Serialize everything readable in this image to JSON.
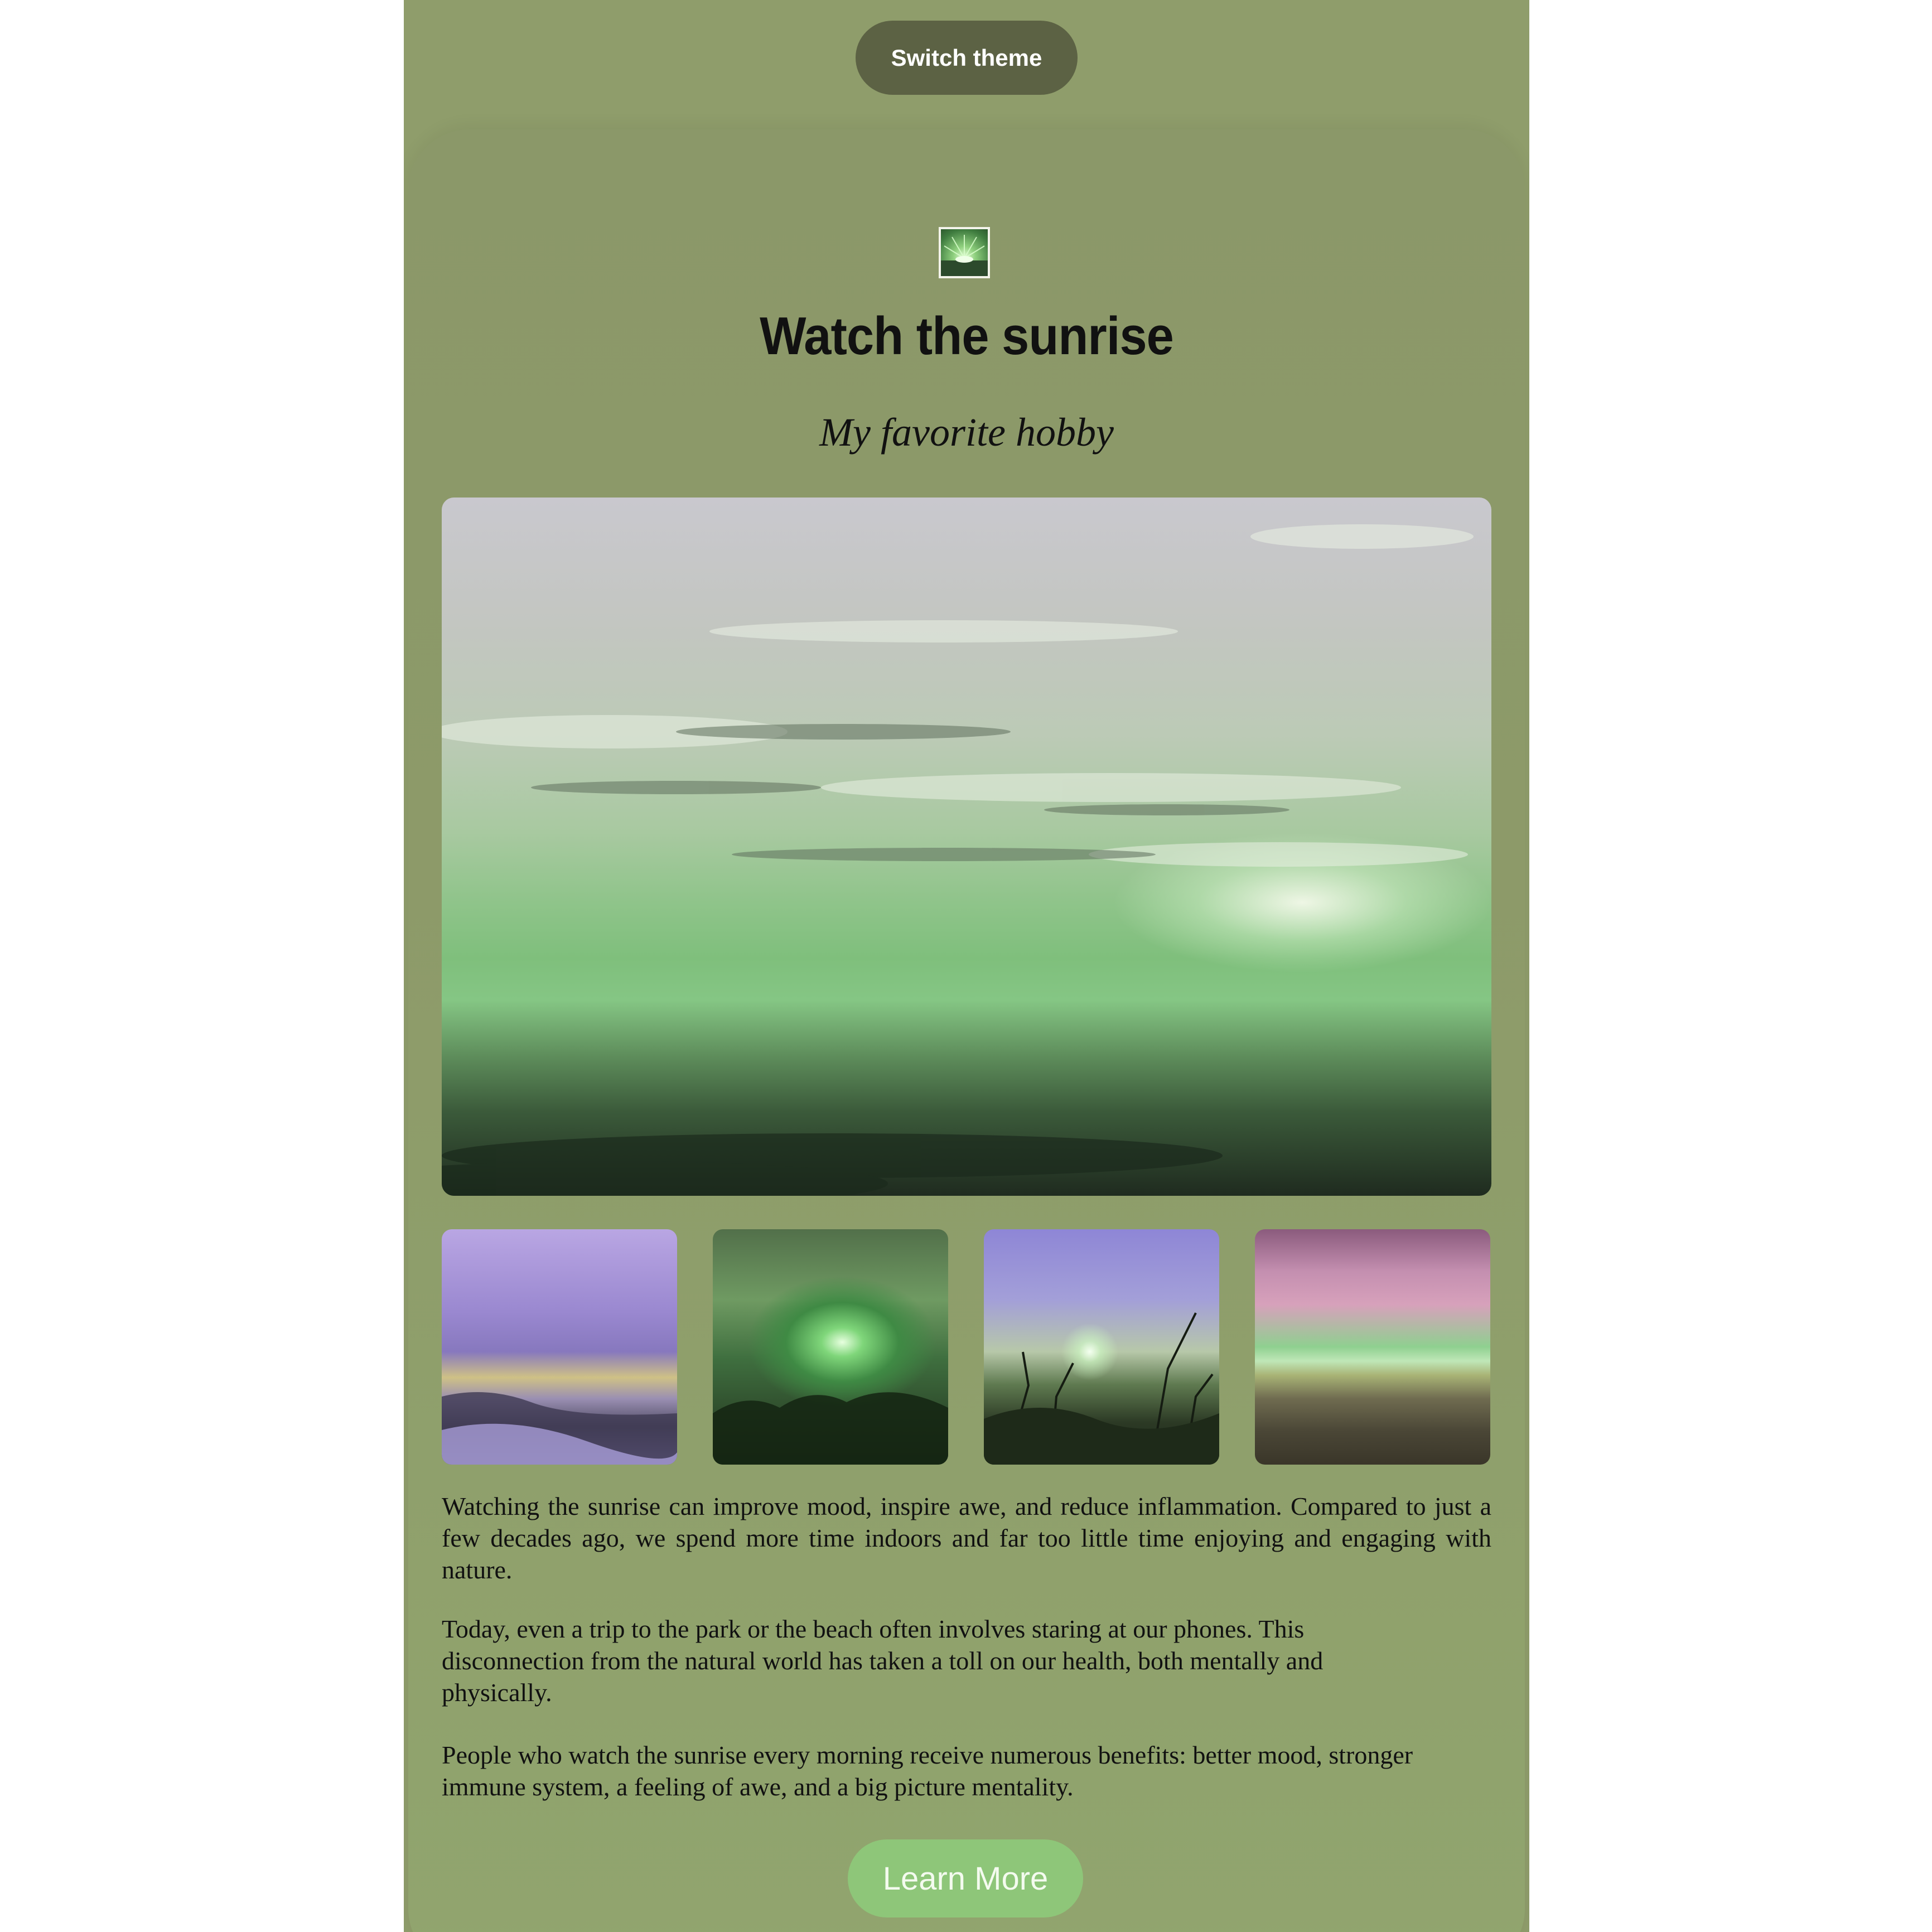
{
  "header": {
    "switch_theme_label": "Switch theme"
  },
  "article": {
    "title": "Watch the sunrise",
    "subtitle": "My favorite hobby",
    "paragraphs": [
      "Watching the sunrise can improve mood, inspire awe, and reduce inflammation. Compared to just a few decades ago, we spend more time indoors and far too little time enjoying and engaging with nature.",
      "Today, even a trip to the park or the beach often involves staring at our phones. This disconnection from the natural world has taken a toll on our health, both mentally and physically.",
      "People who watch the sunrise every morning receive numerous benefits: better mood, stronger immune system, a feeling of awe, and a big picture mentality."
    ],
    "learn_more_label": "Learn More"
  },
  "colors": {
    "page_background": "#8f9d6b",
    "switch_button": "#5c6244",
    "learn_more_button": "#8ec679",
    "text": "#111111"
  },
  "icons": {
    "logo": "sunrise-logo-icon"
  }
}
